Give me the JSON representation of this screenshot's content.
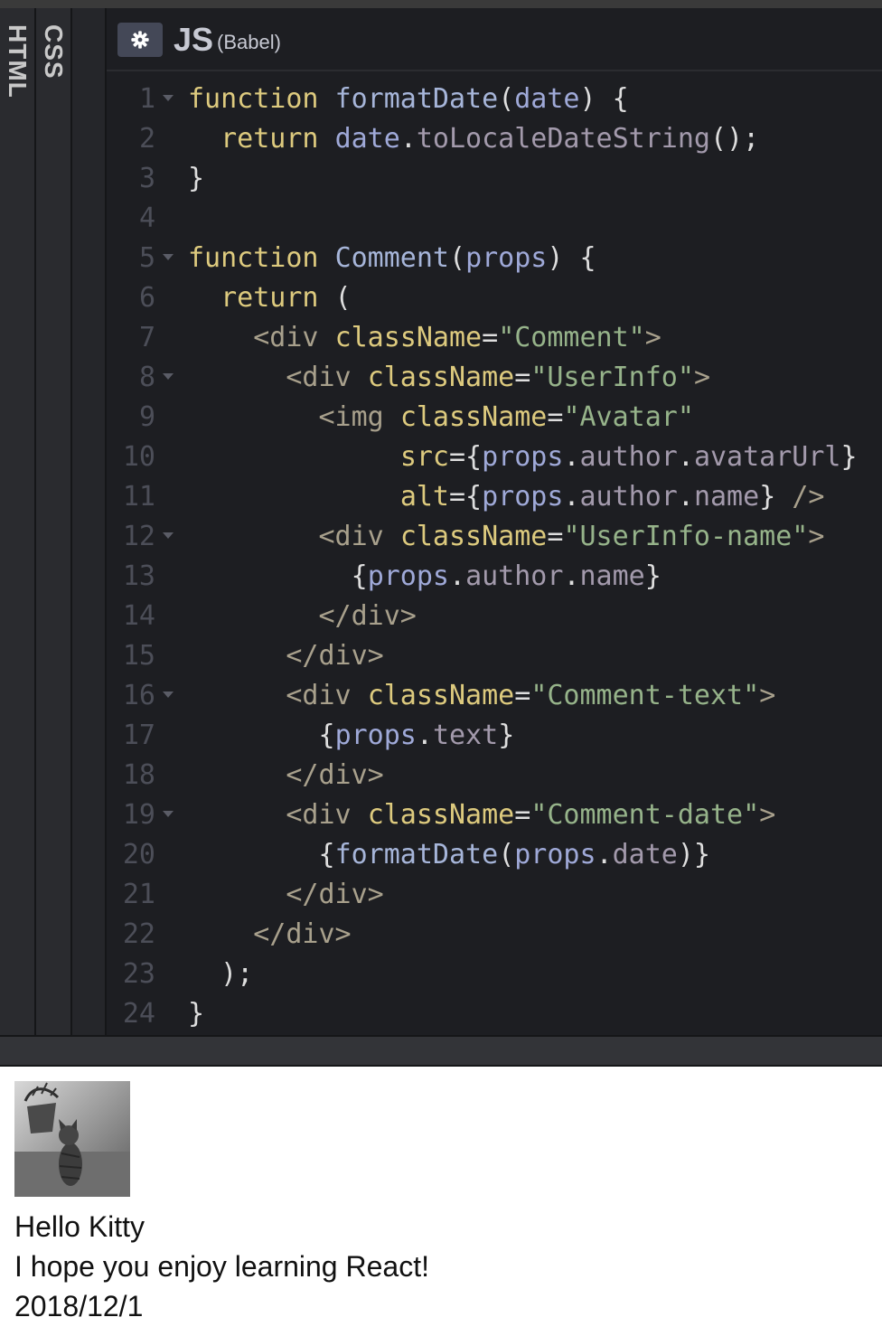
{
  "sidebar": {
    "tabs": [
      {
        "label": "HTML"
      },
      {
        "label": "CSS"
      }
    ]
  },
  "editor": {
    "language": "JS",
    "language_sub": "(Babel)",
    "settings_icon": "gear-icon",
    "lines": [
      {
        "n": "1",
        "fold": true,
        "tokens": [
          [
            "kw",
            "function"
          ],
          [
            "p",
            " "
          ],
          [
            "fn",
            "formatDate"
          ],
          [
            "p",
            "("
          ],
          [
            "var",
            "date"
          ],
          [
            "p",
            ") {"
          ]
        ]
      },
      {
        "n": "2",
        "fold": false,
        "tokens": [
          [
            "p",
            "  "
          ],
          [
            "kw",
            "return"
          ],
          [
            "p",
            " "
          ],
          [
            "var",
            "date"
          ],
          [
            "p",
            "."
          ],
          [
            "prop",
            "toLocaleDateString"
          ],
          [
            "p",
            "();"
          ]
        ]
      },
      {
        "n": "3",
        "fold": false,
        "tokens": [
          [
            "p",
            "}"
          ]
        ]
      },
      {
        "n": "4",
        "fold": false,
        "tokens": []
      },
      {
        "n": "5",
        "fold": true,
        "tokens": [
          [
            "kw",
            "function"
          ],
          [
            "p",
            " "
          ],
          [
            "fn",
            "Comment"
          ],
          [
            "p",
            "("
          ],
          [
            "var",
            "props"
          ],
          [
            "p",
            ") {"
          ]
        ]
      },
      {
        "n": "6",
        "fold": false,
        "tokens": [
          [
            "p",
            "  "
          ],
          [
            "kw",
            "return"
          ],
          [
            "p",
            " ("
          ]
        ]
      },
      {
        "n": "7",
        "fold": false,
        "tokens": [
          [
            "p",
            "    "
          ],
          [
            "tag",
            "<div"
          ],
          [
            "p",
            " "
          ],
          [
            "attr",
            "className"
          ],
          [
            "p",
            "="
          ],
          [
            "str",
            "\"Comment\""
          ],
          [
            "tag",
            ">"
          ]
        ]
      },
      {
        "n": "8",
        "fold": true,
        "tokens": [
          [
            "p",
            "      "
          ],
          [
            "tag",
            "<div"
          ],
          [
            "p",
            " "
          ],
          [
            "attr",
            "className"
          ],
          [
            "p",
            "="
          ],
          [
            "str",
            "\"UserInfo\""
          ],
          [
            "tag",
            ">"
          ]
        ]
      },
      {
        "n": "9",
        "fold": false,
        "tokens": [
          [
            "p",
            "        "
          ],
          [
            "tag",
            "<img"
          ],
          [
            "p",
            " "
          ],
          [
            "attr",
            "className"
          ],
          [
            "p",
            "="
          ],
          [
            "str",
            "\"Avatar\""
          ]
        ]
      },
      {
        "n": "10",
        "fold": false,
        "tokens": [
          [
            "p",
            "             "
          ],
          [
            "attr",
            "src"
          ],
          [
            "p",
            "={"
          ],
          [
            "var",
            "props"
          ],
          [
            "p",
            "."
          ],
          [
            "prop",
            "author"
          ],
          [
            "p",
            "."
          ],
          [
            "prop",
            "avatarUrl"
          ],
          [
            "p",
            "}"
          ]
        ]
      },
      {
        "n": "11",
        "fold": false,
        "tokens": [
          [
            "p",
            "             "
          ],
          [
            "attr",
            "alt"
          ],
          [
            "p",
            "={"
          ],
          [
            "var",
            "props"
          ],
          [
            "p",
            "."
          ],
          [
            "prop",
            "author"
          ],
          [
            "p",
            "."
          ],
          [
            "prop",
            "name"
          ],
          [
            "p",
            "} "
          ],
          [
            "tag",
            "/>"
          ]
        ]
      },
      {
        "n": "12",
        "fold": true,
        "tokens": [
          [
            "p",
            "        "
          ],
          [
            "tag",
            "<div"
          ],
          [
            "p",
            " "
          ],
          [
            "attr",
            "className"
          ],
          [
            "p",
            "="
          ],
          [
            "str",
            "\"UserInfo-name\""
          ],
          [
            "tag",
            ">"
          ]
        ]
      },
      {
        "n": "13",
        "fold": false,
        "tokens": [
          [
            "p",
            "          {"
          ],
          [
            "var",
            "props"
          ],
          [
            "p",
            "."
          ],
          [
            "prop",
            "author"
          ],
          [
            "p",
            "."
          ],
          [
            "prop",
            "name"
          ],
          [
            "p",
            "}"
          ]
        ]
      },
      {
        "n": "14",
        "fold": false,
        "tokens": [
          [
            "p",
            "        "
          ],
          [
            "tag",
            "</div>"
          ]
        ]
      },
      {
        "n": "15",
        "fold": false,
        "tokens": [
          [
            "p",
            "      "
          ],
          [
            "tag",
            "</div>"
          ]
        ]
      },
      {
        "n": "16",
        "fold": true,
        "tokens": [
          [
            "p",
            "      "
          ],
          [
            "tag",
            "<div"
          ],
          [
            "p",
            " "
          ],
          [
            "attr",
            "className"
          ],
          [
            "p",
            "="
          ],
          [
            "str",
            "\"Comment-text\""
          ],
          [
            "tag",
            ">"
          ]
        ]
      },
      {
        "n": "17",
        "fold": false,
        "tokens": [
          [
            "p",
            "        {"
          ],
          [
            "var",
            "props"
          ],
          [
            "p",
            "."
          ],
          [
            "prop",
            "text"
          ],
          [
            "p",
            "}"
          ]
        ]
      },
      {
        "n": "18",
        "fold": false,
        "tokens": [
          [
            "p",
            "      "
          ],
          [
            "tag",
            "</div>"
          ]
        ]
      },
      {
        "n": "19",
        "fold": true,
        "tokens": [
          [
            "p",
            "      "
          ],
          [
            "tag",
            "<div"
          ],
          [
            "p",
            " "
          ],
          [
            "attr",
            "className"
          ],
          [
            "p",
            "="
          ],
          [
            "str",
            "\"Comment-date\""
          ],
          [
            "tag",
            ">"
          ]
        ]
      },
      {
        "n": "20",
        "fold": false,
        "tokens": [
          [
            "p",
            "        {"
          ],
          [
            "fn",
            "formatDate"
          ],
          [
            "p",
            "("
          ],
          [
            "var",
            "props"
          ],
          [
            "p",
            "."
          ],
          [
            "prop",
            "date"
          ],
          [
            "p",
            ")}"
          ]
        ]
      },
      {
        "n": "21",
        "fold": false,
        "tokens": [
          [
            "p",
            "      "
          ],
          [
            "tag",
            "</div>"
          ]
        ]
      },
      {
        "n": "22",
        "fold": false,
        "tokens": [
          [
            "p",
            "    "
          ],
          [
            "tag",
            "</div>"
          ]
        ]
      },
      {
        "n": "23",
        "fold": false,
        "tokens": [
          [
            "p",
            "  );"
          ]
        ]
      },
      {
        "n": "24",
        "fold": false,
        "tokens": [
          [
            "p",
            "}"
          ]
        ]
      }
    ]
  },
  "preview": {
    "avatar_icon": "cat-photo",
    "author_name": "Hello Kitty",
    "comment_text": "I hope you enjoy learning React!",
    "date": "2018/12/1"
  },
  "colors": {
    "editor_bg": "#1d1e22",
    "keyword": "#ddca7e",
    "function_name": "#a6b5d9",
    "variable": "#9fa9d8",
    "property": "#a39aac",
    "string": "#96b38a",
    "tag": "#a8a08c",
    "line_number": "#4c4e58"
  }
}
